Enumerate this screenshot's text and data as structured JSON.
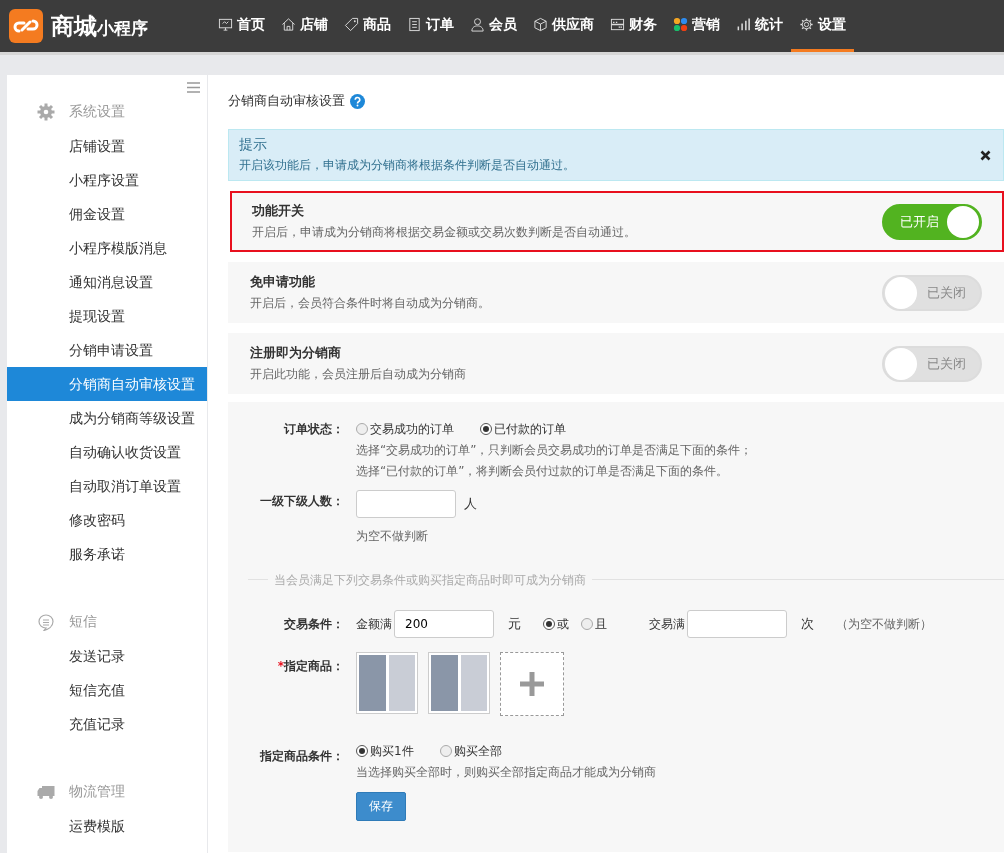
{
  "header": {
    "logo_main": "商城",
    "logo_sub": "小程序",
    "nav": [
      {
        "label": "首页",
        "kind": "monitor",
        "selected": false
      },
      {
        "label": "店铺",
        "kind": "house",
        "selected": false
      },
      {
        "label": "商品",
        "kind": "tag",
        "selected": false
      },
      {
        "label": "订单",
        "kind": "doc",
        "selected": false
      },
      {
        "label": "会员",
        "kind": "person",
        "selected": false
      },
      {
        "label": "供应商",
        "kind": "cube",
        "selected": false
      },
      {
        "label": "财务",
        "kind": "abacus",
        "selected": false
      },
      {
        "label": "营销",
        "kind": "petals",
        "selected": false
      },
      {
        "label": "统计",
        "kind": "bars",
        "selected": false
      },
      {
        "label": "设置",
        "kind": "gear",
        "selected": true
      }
    ]
  },
  "sidebar": {
    "groups": [
      {
        "title": "系统设置",
        "kind": "gear",
        "items": [
          {
            "label": "店铺设置",
            "selected": false
          },
          {
            "label": "小程序设置",
            "selected": false
          },
          {
            "label": "佣金设置",
            "selected": false
          },
          {
            "label": "小程序模版消息",
            "selected": false
          },
          {
            "label": "通知消息设置",
            "selected": false
          },
          {
            "label": "提现设置",
            "selected": false
          },
          {
            "label": "分销申请设置",
            "selected": false
          },
          {
            "label": "分销商自动审核设置",
            "selected": true
          },
          {
            "label": "成为分销商等级设置",
            "selected": false
          },
          {
            "label": "自动确认收货设置",
            "selected": false
          },
          {
            "label": "自动取消订单设置",
            "selected": false
          },
          {
            "label": "修改密码",
            "selected": false
          },
          {
            "label": "服务承诺",
            "selected": false
          }
        ]
      },
      {
        "title": "短信",
        "kind": "chat",
        "items": [
          {
            "label": "发送记录",
            "selected": false
          },
          {
            "label": "短信充值",
            "selected": false
          },
          {
            "label": "充值记录",
            "selected": false
          }
        ]
      },
      {
        "title": "物流管理",
        "kind": "truck",
        "items": [
          {
            "label": "运费模版",
            "selected": false
          }
        ]
      }
    ]
  },
  "page": {
    "title": "分销商自动审核设置",
    "notice": {
      "title": "提示",
      "text": "开启该功能后，申请成为分销商将根据条件判断是否自动通过。"
    },
    "switches": [
      {
        "title": "功能开关",
        "desc": "开启后，申请成为分销商将根据交易金额或交易次数判断是否自动通过。",
        "on": true,
        "state_label": "已开启",
        "highlighted": true
      },
      {
        "title": "免申请功能",
        "desc": "开启后，会员符合条件时将自动成为分销商。",
        "on": false,
        "state_label": "已关闭",
        "highlighted": false
      },
      {
        "title": "注册即为分销商",
        "desc": "开启此功能，会员注册后自动成为分销商",
        "on": false,
        "state_label": "已关闭",
        "highlighted": false
      }
    ],
    "form": {
      "order_status": {
        "label": "订单状态：",
        "options": [
          {
            "label": "交易成功的订单",
            "selected": false
          },
          {
            "label": "已付款的订单",
            "selected": true
          }
        ],
        "hints": [
          "选择“交易成功的订单”，只判断会员交易成功的订单是否满足下面的条件；",
          "选择“已付款的订单”，将判断会员付过款的订单是否满足下面的条件。"
        ]
      },
      "subordinates": {
        "label": "一级下级人数：",
        "unit": "人",
        "hint": "为空不做判断"
      },
      "divider_text": "当会员满足下列交易条件或购买指定商品时即可成为分销商",
      "trade": {
        "label": "交易条件：",
        "amount_label": "金额满",
        "amount_value": "200",
        "amount_unit": "元",
        "logic": [
          {
            "label": "或",
            "selected": true
          },
          {
            "label": "且",
            "selected": false
          }
        ],
        "count_label": "交易满",
        "count_unit": "次",
        "count_hint": "（为空不做判断）"
      },
      "products": {
        "required_mark": "*",
        "label": "指定商品：",
        "thumbnails": [
          {
            "kind": "photo"
          },
          {
            "kind": "photo"
          }
        ]
      },
      "product_condition": {
        "label": "指定商品条件：",
        "options": [
          {
            "label": "购买1件",
            "selected": true
          },
          {
            "label": "购买全部",
            "selected": false
          }
        ],
        "hint": "当选择购买全部时，则购买全部指定商品才能成为分销商"
      },
      "save": "保存"
    }
  }
}
